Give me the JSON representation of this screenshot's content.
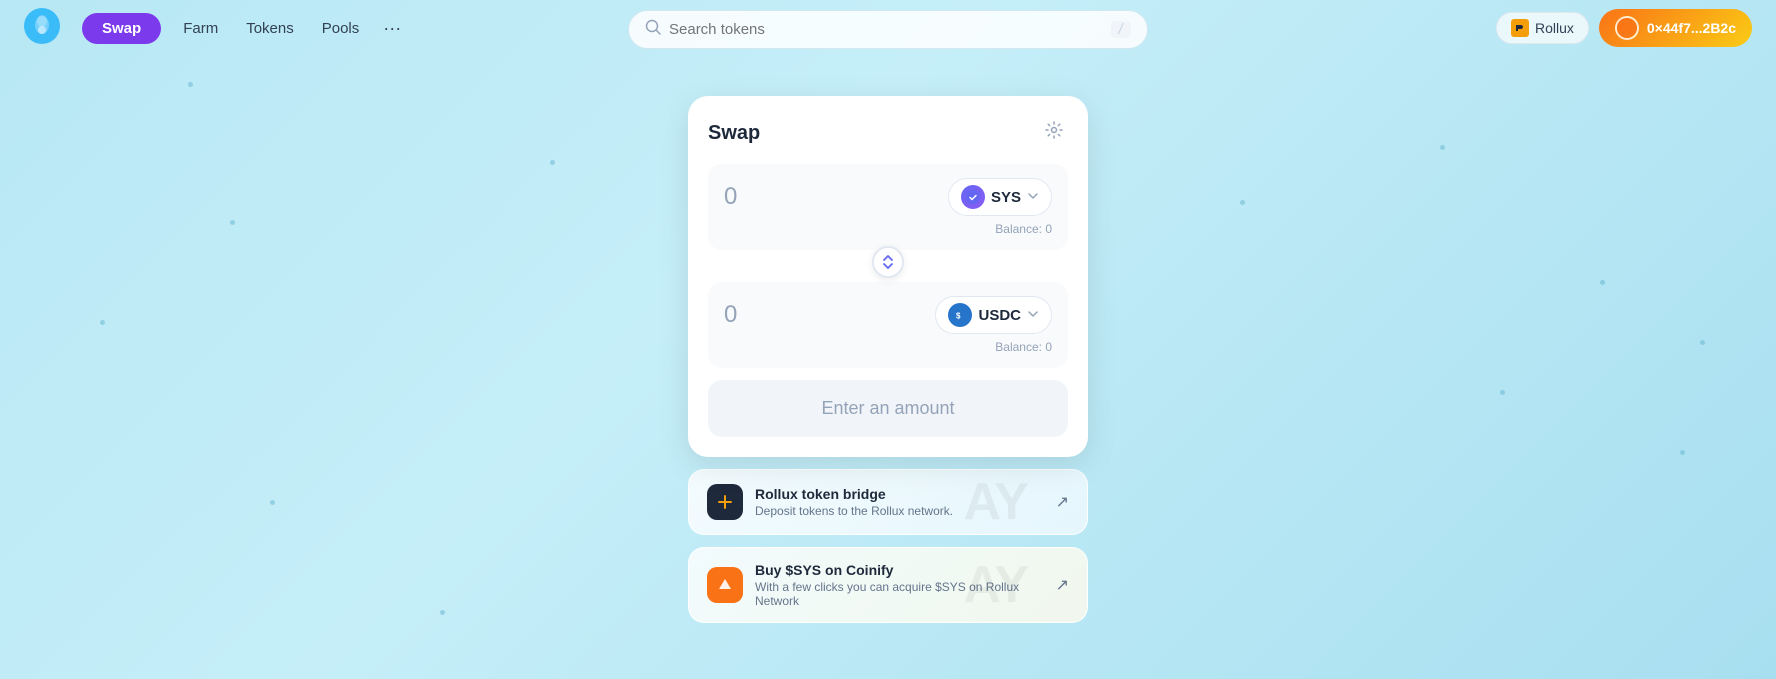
{
  "navbar": {
    "swap_label": "Swap",
    "farm_label": "Farm",
    "tokens_label": "Tokens",
    "pools_label": "Pools",
    "more_label": "···",
    "search_placeholder": "Search tokens",
    "search_shortcut": "/",
    "rollux_label": "Rollux",
    "wallet_address": "0×44f7...2B2c"
  },
  "swap_card": {
    "title": "Swap",
    "from_amount": "0",
    "from_token": "SYS",
    "from_balance_label": "Balance:",
    "from_balance_value": "0",
    "to_amount": "0",
    "to_token": "USDC",
    "to_balance_label": "Balance:",
    "to_balance_value": "0",
    "enter_amount": "Enter an amount"
  },
  "info_cards": [
    {
      "id": "bridge",
      "title": "Rollux token bridge",
      "description": "Deposit tokens to the Rollux network.",
      "bg_text": "AY"
    },
    {
      "id": "coinify",
      "title": "Buy $SYS on Coinify",
      "description": "With a few clicks you can acquire $SYS on Rollux Network",
      "bg_text": "AY"
    }
  ],
  "icons": {
    "search": "🔍",
    "settings": "⚙",
    "swap_arrows": "⇄",
    "chevron_down": "▾",
    "external_link": "↗",
    "bridge_icon": "⬛",
    "coinify_icon": "◆"
  }
}
